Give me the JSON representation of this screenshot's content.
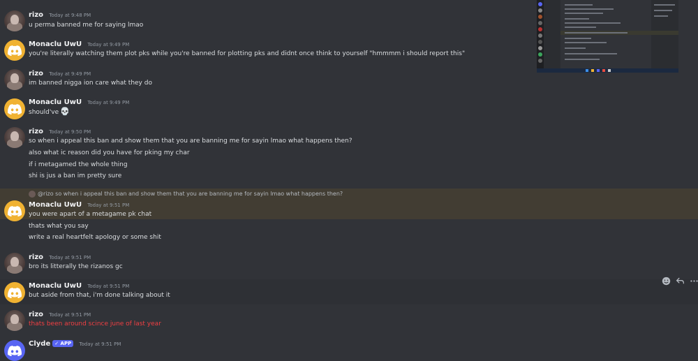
{
  "messages": [
    {
      "author": "rizo",
      "timestamp": "Today at 9:48 PM",
      "lines": [
        "u perma banned me for saying lmao"
      ]
    },
    {
      "author": "Monaclu UwU",
      "timestamp": "Today at 9:49 PM",
      "lines": [
        "you're literally watching them plot pks while you're banned for plotting pks and didnt once think to yourself \"hmmmm i should report this\""
      ]
    },
    {
      "author": "rizo",
      "timestamp": "Today at 9:49 PM",
      "lines": [
        "im banned nigga ion care what they do"
      ]
    },
    {
      "author": "Monaclu UwU",
      "timestamp": "Today at 9:49 PM",
      "lines": [
        "should've"
      ],
      "emoji": "skull"
    },
    {
      "author": "rizo",
      "timestamp": "Today at 9:50 PM",
      "lines": [
        "so when i appeal this ban and show them that you are banning me for sayin lmao what happens then?",
        "also what ic reason did you have for pking my char",
        "if i metagamed the whole thing",
        "shi is jus a ban im pretty sure"
      ]
    },
    {
      "author": "Monaclu UwU",
      "timestamp": "Today at 9:51 PM",
      "reply_to": "@rizo so when i appeal this ban and show them that you are banning me for sayin lmao what happens then?",
      "lines": [
        "you were apart of a metagame pk chat",
        "thats what you say",
        "write a real heartfelt apology or some shit"
      ]
    },
    {
      "author": "rizo",
      "timestamp": "Today at 9:51 PM",
      "lines": [
        "bro its litterally the rizanos gc"
      ]
    },
    {
      "author": "Monaclu UwU",
      "timestamp": "Today at 9:51 PM",
      "lines": [
        "but aside from that, i'm done talking about it"
      ]
    },
    {
      "author": "rizo",
      "timestamp": "Today at 9:51 PM",
      "lines": [
        "thats been around scince june of last year"
      ]
    },
    {
      "author": "Clyde",
      "badge": "APP",
      "timestamp": "Today at 9:51 PM",
      "lines": []
    }
  ],
  "colors": {
    "background": "#313338",
    "reply_highlight": "#423d33",
    "red_text": "#f23f43",
    "monaclu_avatar": "#f0b232",
    "clyde_avatar": "#5865f2"
  },
  "icons": {
    "reaction": "add-reaction-icon",
    "reply": "reply-icon",
    "more": "more-options-icon"
  }
}
